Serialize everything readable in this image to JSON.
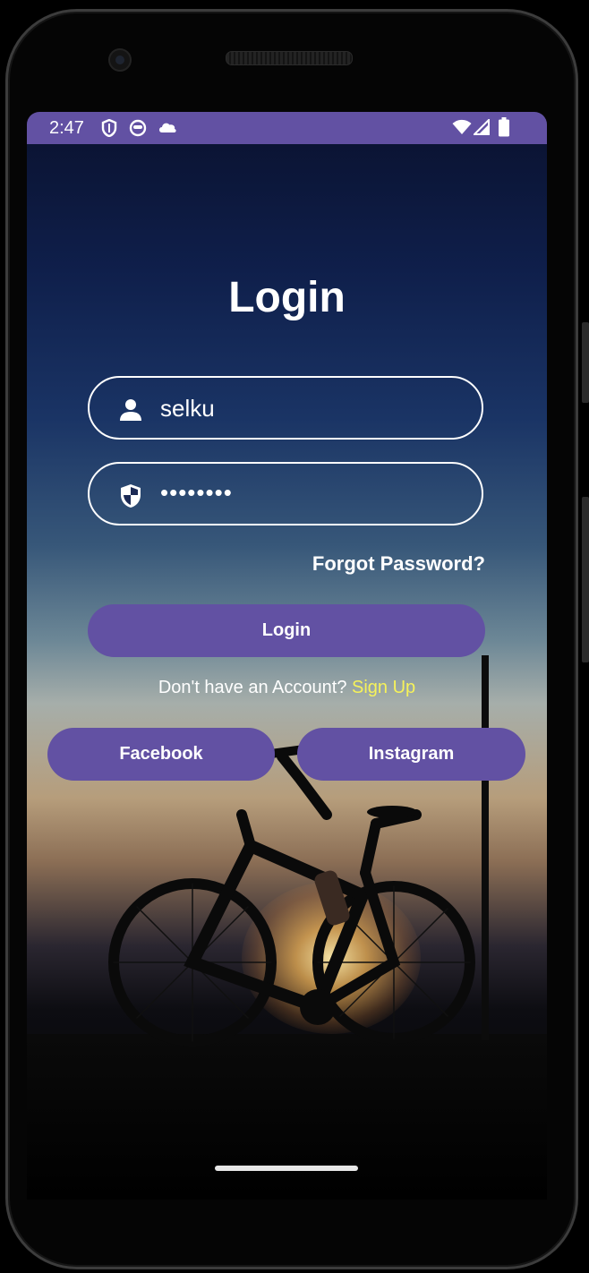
{
  "status_bar": {
    "time": "2:47",
    "left_icons": [
      "shield-outline-icon",
      "robot-face-icon",
      "cloud-icon"
    ],
    "right_icons": [
      "wifi-icon",
      "signal-icon",
      "battery-icon"
    ],
    "color": "#6251a3"
  },
  "login": {
    "title": "Login",
    "username": {
      "value": "selku",
      "icon": "person-icon"
    },
    "password": {
      "value": "••••••••",
      "icon": "shield-icon"
    },
    "forgot_password": "Forgot Password?",
    "login_button": "Login",
    "signup_prompt": "Don't have an Account?",
    "signup_link": "Sign Up",
    "facebook_button": "Facebook",
    "instagram_button": "Instagram"
  },
  "colors": {
    "accent": "#6251a3",
    "link": "#f6f25a",
    "text": "#ffffff"
  }
}
